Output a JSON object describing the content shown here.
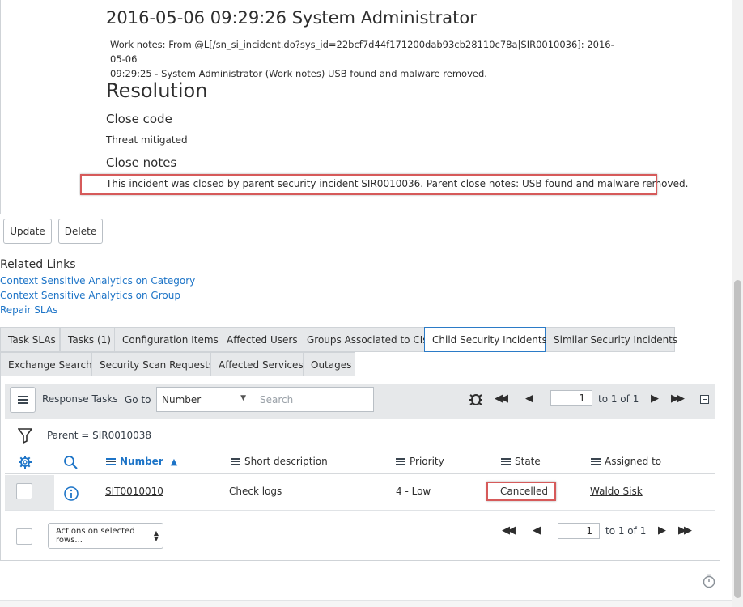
{
  "activity": {
    "entry_header": "2016-05-06 09:29:26 System Administrator",
    "work_notes_line1": "Work notes: From @L[/sn_si_incident.do?sys_id=22bcf7d44f171200dab93cb28110c78a|SIR0010036]: 2016-05-06",
    "work_notes_line2": "09:29:25 - System Administrator (Work notes) USB found and malware removed."
  },
  "resolution": {
    "heading": "Resolution",
    "close_code_label": "Close code",
    "close_code_value": "Threat mitigated",
    "close_notes_label": "Close notes",
    "close_notes_value": "This incident was closed by parent security incident SIR0010036. Parent close notes: USB found and malware removed."
  },
  "form_buttons": {
    "update": "Update",
    "delete": "Delete"
  },
  "related_links": {
    "title": "Related Links",
    "items": [
      "Context Sensitive Analytics on Category",
      "Context Sensitive Analytics on Group",
      "Repair SLAs"
    ]
  },
  "tabs": {
    "row1": [
      "Task SLAs",
      "Tasks (1)",
      "Configuration Items",
      "Affected Users",
      "Groups Associated to CIs",
      "Child Security Incidents",
      "Similar Security Incidents"
    ],
    "row2": [
      "Exchange Search",
      "Security Scan Requests",
      "Affected Services",
      "Outages"
    ],
    "active": "Child Security Incidents"
  },
  "list": {
    "title": "Response Tasks",
    "goto_label": "Go to",
    "goto_field": "Number",
    "search_placeholder": "Search",
    "page_value": "1",
    "page_total": "to 1 of 1",
    "filter_text": "Parent = SIR0010038",
    "columns": {
      "number": "Number",
      "short_description": "Short description",
      "priority": "Priority",
      "state": "State",
      "assigned_to": "Assigned to"
    },
    "rows": [
      {
        "number": "SIT0010010",
        "short_description": "Check logs",
        "priority": "4 - Low",
        "state": "Cancelled",
        "assigned_to": "Waldo Sisk"
      }
    ],
    "actions_label": "Actions on selected rows...",
    "bottom_page_value": "1",
    "bottom_page_total": "to 1 of 1"
  },
  "colors": {
    "link": "#1d74c7",
    "highlight": "#d65a5a",
    "active_tab_border": "#2b7bc7",
    "toolbar_bg": "#e6e8ea"
  },
  "icons": [
    "hamburger-icon",
    "bug-icon",
    "first-page-icon",
    "prev-page-icon",
    "next-page-icon",
    "last-page-icon",
    "collapse-icon",
    "filter-icon",
    "gear-icon",
    "search-icon",
    "sort-asc-icon",
    "info-icon",
    "timer-icon"
  ]
}
